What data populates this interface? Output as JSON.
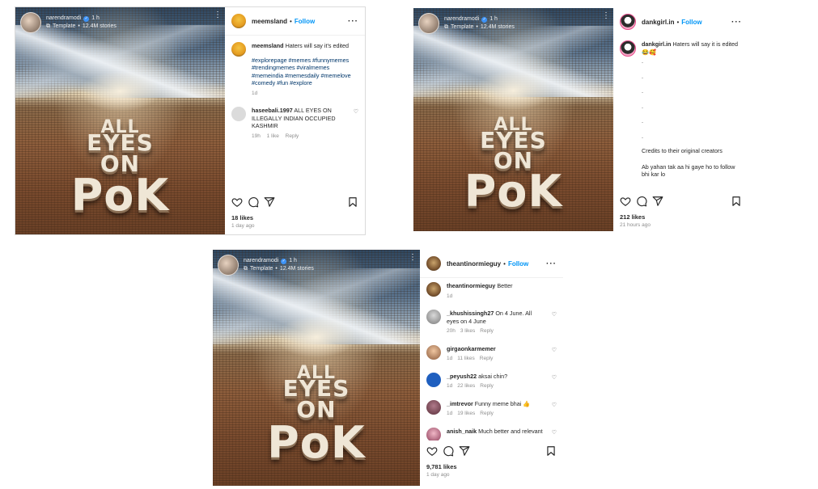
{
  "overlay": {
    "username": "narendramodi",
    "time": "1 h",
    "template_text": "Template",
    "stories": "12.4M stories"
  },
  "image_text": {
    "line1": "ALL",
    "line2": "EYES",
    "line3": "ON",
    "line4": "PoK"
  },
  "post1": {
    "username": "meemsland",
    "follow": "Follow",
    "caption_user": "meemsland",
    "caption": "Haters will say it's edited",
    "hashtags": "#explorepage #memes #funnymemes #trendingmemes #viralmemes #memeindia #memesdaily #memelove #comedy #fun #explore",
    "caption_age": "1d",
    "comment": {
      "user": "haseebali.1997",
      "text": "ALL EYES ON ILLEGALLY INDIAN OCCUPIED KASHMIR",
      "age": "19h",
      "likes": "1 like",
      "reply": "Reply"
    },
    "likes": "18 likes",
    "ago": "1 day ago"
  },
  "post2": {
    "username": "dankgirl.in",
    "follow": "Follow",
    "caption_user": "dankgirl.in",
    "caption": "Haters will say it is edited",
    "caption_emoji": "😂🥰",
    "dots": [
      ".",
      ".",
      ".",
      ".",
      ".",
      "."
    ],
    "credits": "Credits to their original creators",
    "extra": "Ab yahan tak aa hi gaye ho to follow bhi kar lo",
    "likes": "212 likes",
    "ago": "21 hours ago"
  },
  "post3": {
    "username": "theantinormieguy",
    "follow": "Follow",
    "caption_user": "theantinormieguy",
    "caption": "Better",
    "caption_age": "1d",
    "comments": [
      {
        "user": "_khushissingh27",
        "text": "On 4 June. All eyes on 4 June",
        "age": "20h",
        "likes": "3 likes",
        "reply": "Reply",
        "avatar": "k"
      },
      {
        "user": "girgaonkarmemer",
        "text": "",
        "age": "1d",
        "likes": "11 likes",
        "reply": "Reply",
        "avatar": "g"
      },
      {
        "user": "_peyush22",
        "text": "aksai chin?",
        "age": "1d",
        "likes": "22 likes",
        "reply": "Reply",
        "avatar": "p"
      },
      {
        "user": "_imtrevor",
        "text": "Funny meme bhai 👍",
        "age": "1d",
        "likes": "19 likes",
        "reply": "Reply",
        "avatar": "i"
      },
      {
        "user": "anish_naik",
        "text": "Much better and relevant",
        "age": "",
        "likes": "",
        "reply": "",
        "avatar": "a"
      }
    ],
    "likes": "9,781 likes",
    "ago": "1 day ago"
  },
  "icons": [
    "heart-icon",
    "comment-icon",
    "share-icon",
    "save-icon",
    "more-icon",
    "verified-icon",
    "template-icon"
  ]
}
